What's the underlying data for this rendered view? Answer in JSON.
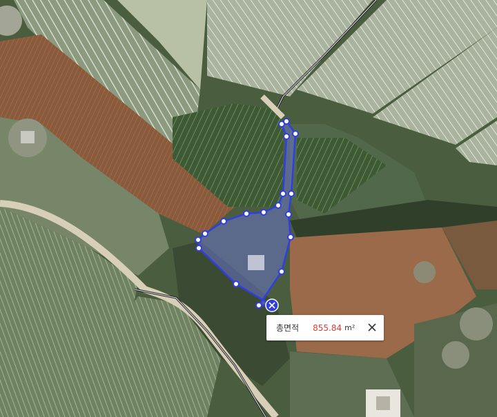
{
  "measurement": {
    "label": "총면적",
    "value": "855.84",
    "unit": "m²"
  },
  "colors": {
    "polygon_stroke": "#2f3fe0",
    "polygon_fill": "#6a72c8",
    "value_text": "#e23b2e"
  },
  "icons": {
    "vertex": "vertex-handle-icon",
    "delete": "delete-polygon-icon",
    "close": "close-icon"
  }
}
